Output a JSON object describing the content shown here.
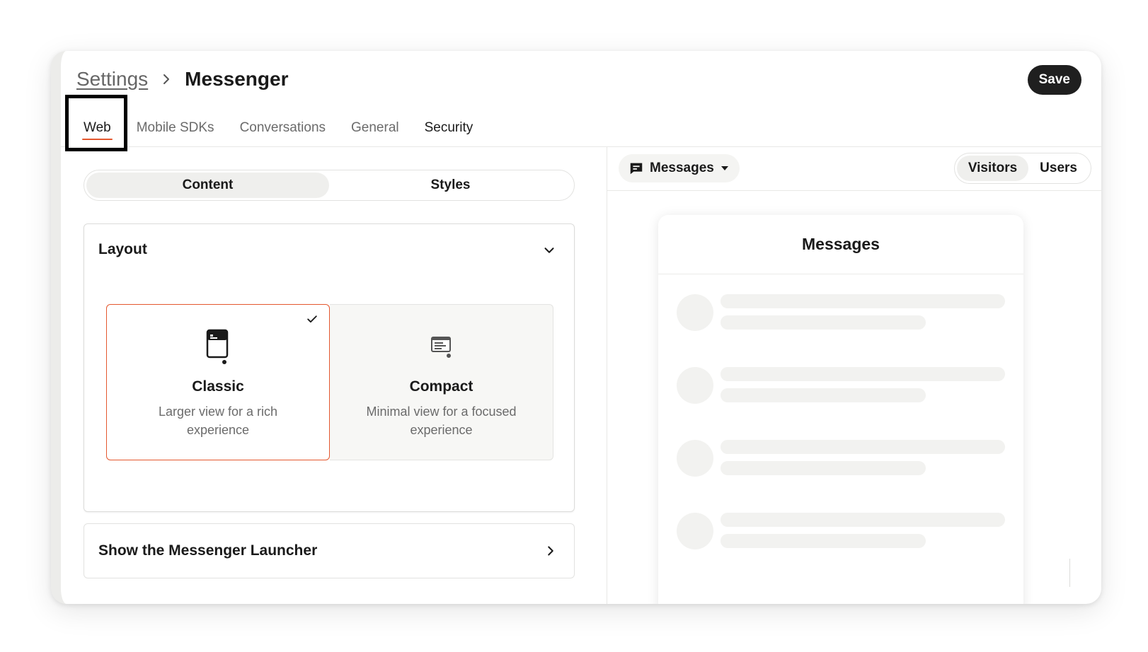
{
  "breadcrumb": {
    "parent": "Settings",
    "current": "Messenger"
  },
  "header": {
    "save_label": "Save"
  },
  "tabs": [
    {
      "label": "Web",
      "active": true
    },
    {
      "label": "Mobile SDKs",
      "active": false
    },
    {
      "label": "Conversations",
      "active": false
    },
    {
      "label": "General",
      "active": false
    },
    {
      "label": "Security",
      "active": false
    }
  ],
  "editor": {
    "segments": [
      "Content",
      "Styles"
    ],
    "active_segment": "Content"
  },
  "layout_card": {
    "title": "Layout",
    "options": [
      {
        "title": "Classic",
        "description": "Larger view for a rich experience",
        "selected": true,
        "icon": "classic-layout-icon"
      },
      {
        "title": "Compact",
        "description": "Minimal view for a focused experience",
        "selected": false,
        "icon": "compact-layout-icon"
      }
    ]
  },
  "launcher_row": {
    "title": "Show the Messenger Launcher"
  },
  "preview": {
    "dropdown_label": "Messages",
    "audience": [
      "Visitors",
      "Users"
    ],
    "active_audience": "Visitors",
    "panel_title": "Messages"
  },
  "colors": {
    "accent": "#e4572e",
    "dark_button": "#1f1f1f",
    "skeleton": "#f2f2f0"
  }
}
